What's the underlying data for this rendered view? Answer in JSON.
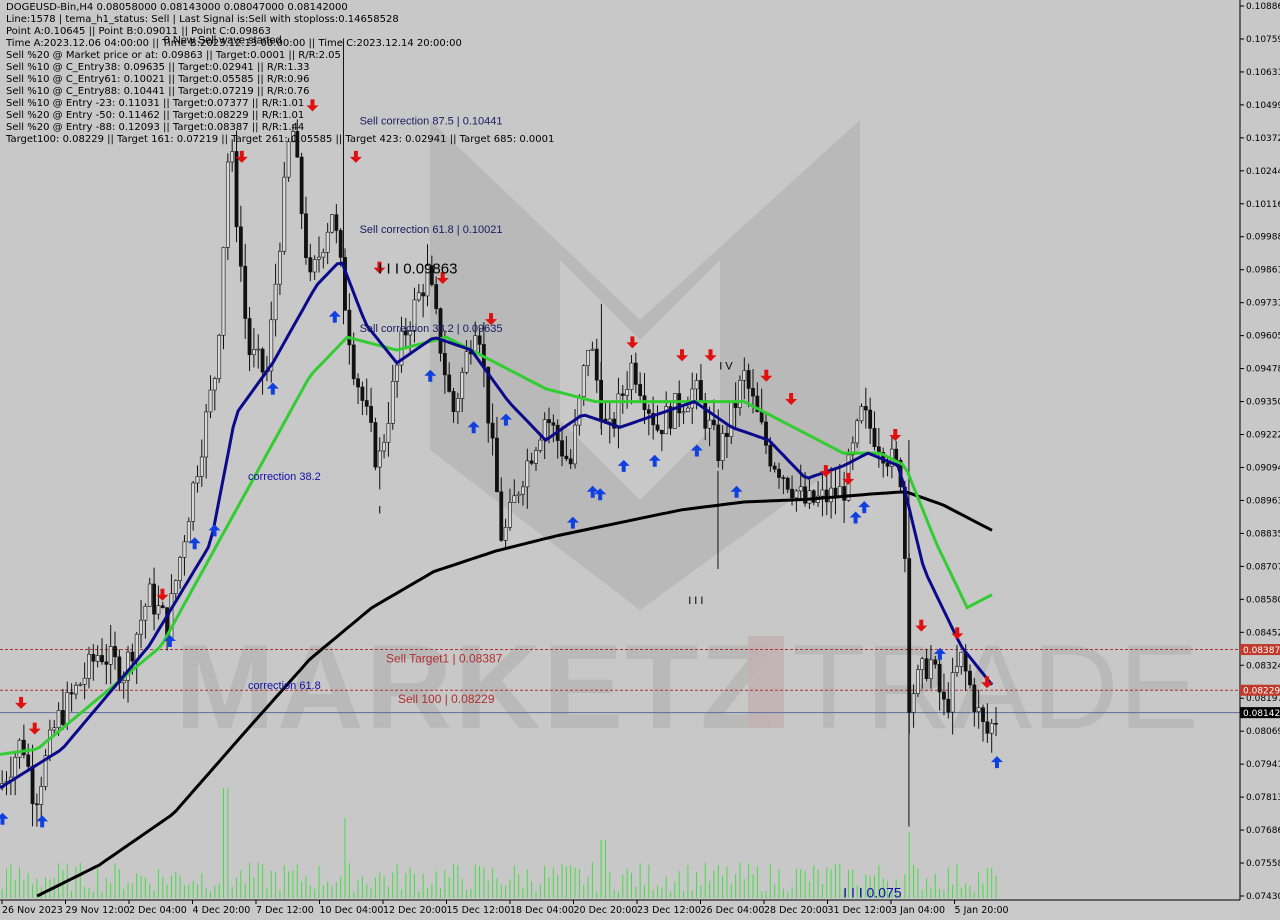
{
  "info": {
    "lines": [
      "DOGEUSD-Bin,H4  0.08058000 0.08143000 0.08047000 0.08142000",
      "Line:1578 | tema_h1_status: Sell | Last Signal is:Sell with stoploss:0.14658528",
      "Point A:0.10645 || Point B:0.09011 || Point C:0.09863",
      "Time A:2023.12.06 04:00:00 || Time B:2023.12.13 00:00:00 || Time C:2023.12.14 20:00:00",
      "Sell %20 @ Market price or at: 0.09863 || Target:0.0001 || R/R:2.05",
      "Sell %10 @ C_Entry38: 0.09635 || Target:0.02941 || R/R:1.33",
      "Sell %10 @ C_Entry61: 0.10021 || Target:0.05585 || R/R:0.96",
      "Sell %10 @ C_Entry88: 0.10441 || Target:0.07219 || R/R:0.76",
      "Sell %10 @ Entry -23: 0.11031 || Target:0.07377 || R/R:1.01",
      "Sell %20 @ Entry -50: 0.11462 || Target:0.08229 || R/R:1.01",
      "Sell %20 @ Entry -88: 0.12093 || Target:0.08387 || R/R:1.44",
      "Target100: 0.08229 || Target 161: 0.07219 || Target 261: 0.05585 || Target 423: 0.02941 || Target 685: 0.0001"
    ]
  },
  "chart_data": {
    "type": "candlestick",
    "symbol": "DOGEUSD-Bin",
    "timeframe": "H4",
    "ylim": [
      0.0743,
      0.10886
    ],
    "price_axis_ticks": [
      "0.10886",
      "0.10759",
      "0.10631",
      "0.10499",
      "0.10372",
      "0.10244",
      "0.10116",
      "0.09988",
      "0.09861",
      "0.09731",
      "0.09605",
      "0.09478",
      "0.09350",
      "0.09222",
      "0.09094",
      "0.08963",
      "0.08835",
      "0.08707",
      "0.08580",
      "0.08452",
      "0.08324",
      "0.08197",
      "0.08069",
      "0.07941",
      "0.07813",
      "0.07686",
      "0.07558",
      "0.07430"
    ],
    "time_axis_labels": [
      "26 Nov 2023",
      "29 Nov 12:00",
      "2 Dec 04:00",
      "4 Dec 20:00",
      "7 Dec 12:00",
      "10 Dec 04:00",
      "12 Dec 20:00",
      "15 Dec 12:00",
      "18 Dec 04:00",
      "20 Dec 20:00",
      "23 Dec 12:00",
      "26 Dec 04:00",
      "28 Dec 20:00",
      "31 Dec 12:00",
      "3 Jan 04:00",
      "5 Jan 20:00"
    ],
    "price_tags": [
      {
        "value": 0.08387,
        "label": "0.08387",
        "color": "#c0392b"
      },
      {
        "value": 0.08229,
        "label": "0.08229",
        "color": "#c0392b"
      },
      {
        "value": 0.08142,
        "label": "0.08142",
        "color": "#000000"
      }
    ],
    "horizontal_levels": [
      {
        "value": 0.08387,
        "style": "dashed",
        "color": "#b03030",
        "label": "Sell Target1 | 0.08387"
      },
      {
        "value": 0.08229,
        "style": "dashed",
        "color": "#b03030",
        "label": "Sell 100 | 0.08229"
      },
      {
        "value": 0.08142,
        "style": "solid",
        "color": "#5a6f9a",
        "label": ""
      }
    ],
    "text_annotations": [
      {
        "text": "Sell correction 87.5 | 0.10441",
        "x_frac": 0.29,
        "y": 0.10441,
        "color": "#1a1a60"
      },
      {
        "text": "Sell correction 61.8 | 0.10021",
        "x_frac": 0.29,
        "y": 0.10021,
        "color": "#1a1a60"
      },
      {
        "text": "Sell correction 38.2 | 0.09635",
        "x_frac": 0.29,
        "y": 0.09635,
        "color": "#1a1a60"
      },
      {
        "text": "I I I 0.09863",
        "x_frac": 0.305,
        "y": 0.09863,
        "color": "#000000",
        "size": 15
      },
      {
        "text": "correction 38.2",
        "x_frac": 0.2,
        "y": 0.0906,
        "color": "#1010aa"
      },
      {
        "text": "correction 61.8",
        "x_frac": 0.2,
        "y": 0.0825,
        "color": "#1010aa"
      },
      {
        "text": "0 New Sell wave started",
        "x_frac": 0.132,
        "y": 0.10755,
        "color": "#000000"
      },
      {
        "text": "I V",
        "x_frac": 0.58,
        "y": 0.0949,
        "color": "#000000"
      },
      {
        "text": "I",
        "x_frac": 0.305,
        "y": 0.0893,
        "color": "#000000"
      },
      {
        "text": "I I I",
        "x_frac": 0.555,
        "y": 0.0858,
        "color": "#000000"
      },
      {
        "text": "I I I 0.075",
        "x_frac": 0.68,
        "y": 0.0744,
        "color": "#1010aa",
        "size": 14
      }
    ],
    "series": [
      {
        "name": "",
        "role": "fast_ma",
        "color": "#0a0a8a"
      },
      {
        "name": "",
        "role": "mid_ma",
        "color": "#33cc33"
      },
      {
        "name": "",
        "role": "slow_ma",
        "color": "#000000"
      }
    ],
    "path_keypoints": [
      [
        0.0,
        0.0785
      ],
      [
        0.018,
        0.0804
      ],
      [
        0.028,
        0.078
      ],
      [
        0.045,
        0.081
      ],
      [
        0.08,
        0.0838
      ],
      [
        0.1,
        0.083
      ],
      [
        0.12,
        0.086
      ],
      [
        0.135,
        0.0848
      ],
      [
        0.155,
        0.09
      ],
      [
        0.175,
        0.095
      ],
      [
        0.185,
        0.104
      ],
      [
        0.2,
        0.0955
      ],
      [
        0.215,
        0.0945
      ],
      [
        0.235,
        0.1045
      ],
      [
        0.25,
        0.098
      ],
      [
        0.268,
        0.101
      ],
      [
        0.285,
        0.095
      ],
      [
        0.305,
        0.091
      ],
      [
        0.325,
        0.096
      ],
      [
        0.345,
        0.0985
      ],
      [
        0.365,
        0.093
      ],
      [
        0.385,
        0.097
      ],
      [
        0.405,
        0.088
      ],
      [
        0.42,
        0.0905
      ],
      [
        0.44,
        0.093
      ],
      [
        0.46,
        0.091
      ],
      [
        0.475,
        0.096
      ],
      [
        0.49,
        0.092
      ],
      [
        0.51,
        0.095
      ],
      [
        0.53,
        0.0925
      ],
      [
        0.56,
        0.094
      ],
      [
        0.58,
        0.0915
      ],
      [
        0.6,
        0.0945
      ],
      [
        0.62,
        0.0915
      ],
      [
        0.65,
        0.0895
      ],
      [
        0.68,
        0.09
      ],
      [
        0.695,
        0.093
      ],
      [
        0.715,
        0.0915
      ],
      [
        0.728,
        0.0905
      ],
      [
        0.733,
        0.082
      ],
      [
        0.75,
        0.0835
      ],
      [
        0.762,
        0.0815
      ],
      [
        0.775,
        0.0835
      ],
      [
        0.795,
        0.0805
      ],
      [
        0.805,
        0.0814
      ]
    ],
    "fast_ma_keypoints": [
      [
        0.0,
        0.0785
      ],
      [
        0.05,
        0.08
      ],
      [
        0.12,
        0.084
      ],
      [
        0.17,
        0.088
      ],
      [
        0.19,
        0.093
      ],
      [
        0.22,
        0.095
      ],
      [
        0.255,
        0.098
      ],
      [
        0.275,
        0.099
      ],
      [
        0.295,
        0.0965
      ],
      [
        0.32,
        0.095
      ],
      [
        0.35,
        0.096
      ],
      [
        0.38,
        0.0955
      ],
      [
        0.41,
        0.0935
      ],
      [
        0.44,
        0.092
      ],
      [
        0.47,
        0.093
      ],
      [
        0.5,
        0.0925
      ],
      [
        0.53,
        0.093
      ],
      [
        0.56,
        0.0935
      ],
      [
        0.59,
        0.0925
      ],
      [
        0.62,
        0.092
      ],
      [
        0.65,
        0.0905
      ],
      [
        0.68,
        0.091
      ],
      [
        0.7,
        0.0915
      ],
      [
        0.725,
        0.091
      ],
      [
        0.745,
        0.087
      ],
      [
        0.775,
        0.084
      ],
      [
        0.8,
        0.0825
      ]
    ],
    "mid_ma_keypoints": [
      [
        0.0,
        0.0798
      ],
      [
        0.03,
        0.08
      ],
      [
        0.08,
        0.082
      ],
      [
        0.13,
        0.084
      ],
      [
        0.17,
        0.0875
      ],
      [
        0.21,
        0.091
      ],
      [
        0.25,
        0.0945
      ],
      [
        0.28,
        0.096
      ],
      [
        0.32,
        0.0955
      ],
      [
        0.36,
        0.096
      ],
      [
        0.4,
        0.095
      ],
      [
        0.44,
        0.094
      ],
      [
        0.48,
        0.0935
      ],
      [
        0.52,
        0.0935
      ],
      [
        0.56,
        0.0935
      ],
      [
        0.6,
        0.0935
      ],
      [
        0.64,
        0.0925
      ],
      [
        0.68,
        0.0915
      ],
      [
        0.71,
        0.0915
      ],
      [
        0.73,
        0.091
      ],
      [
        0.755,
        0.088
      ],
      [
        0.78,
        0.0855
      ],
      [
        0.8,
        0.086
      ]
    ],
    "slow_ma_keypoints": [
      [
        0.03,
        0.0743
      ],
      [
        0.08,
        0.0755
      ],
      [
        0.14,
        0.0775
      ],
      [
        0.2,
        0.0808
      ],
      [
        0.25,
        0.0835
      ],
      [
        0.3,
        0.0855
      ],
      [
        0.35,
        0.0869
      ],
      [
        0.4,
        0.0877
      ],
      [
        0.45,
        0.0883
      ],
      [
        0.5,
        0.0888
      ],
      [
        0.55,
        0.0893
      ],
      [
        0.6,
        0.0896
      ],
      [
        0.65,
        0.0897
      ],
      [
        0.7,
        0.0899
      ],
      [
        0.73,
        0.09
      ],
      [
        0.76,
        0.0895
      ],
      [
        0.8,
        0.0885
      ]
    ],
    "arrows": [
      {
        "x": 0.002,
        "y": 0.0773,
        "dir": "up"
      },
      {
        "x": 0.017,
        "y": 0.0818,
        "dir": "down"
      },
      {
        "x": 0.028,
        "y": 0.0808,
        "dir": "down"
      },
      {
        "x": 0.034,
        "y": 0.0772,
        "dir": "up"
      },
      {
        "x": 0.137,
        "y": 0.0842,
        "dir": "up"
      },
      {
        "x": 0.131,
        "y": 0.086,
        "dir": "down"
      },
      {
        "x": 0.157,
        "y": 0.088,
        "dir": "up"
      },
      {
        "x": 0.173,
        "y": 0.0885,
        "dir": "up"
      },
      {
        "x": 0.195,
        "y": 0.103,
        "dir": "down"
      },
      {
        "x": 0.22,
        "y": 0.094,
        "dir": "up"
      },
      {
        "x": 0.252,
        "y": 0.105,
        "dir": "down"
      },
      {
        "x": 0.27,
        "y": 0.0968,
        "dir": "up"
      },
      {
        "x": 0.287,
        "y": 0.103,
        "dir": "down"
      },
      {
        "x": 0.306,
        "y": 0.0987,
        "dir": "down"
      },
      {
        "x": 0.347,
        "y": 0.0945,
        "dir": "up"
      },
      {
        "x": 0.357,
        "y": 0.0983,
        "dir": "down"
      },
      {
        "x": 0.382,
        "y": 0.0925,
        "dir": "up"
      },
      {
        "x": 0.396,
        "y": 0.0967,
        "dir": "down"
      },
      {
        "x": 0.408,
        "y": 0.0928,
        "dir": "up"
      },
      {
        "x": 0.462,
        "y": 0.0888,
        "dir": "up"
      },
      {
        "x": 0.478,
        "y": 0.09,
        "dir": "up"
      },
      {
        "x": 0.484,
        "y": 0.0899,
        "dir": "up"
      },
      {
        "x": 0.503,
        "y": 0.091,
        "dir": "up"
      },
      {
        "x": 0.51,
        "y": 0.0958,
        "dir": "down"
      },
      {
        "x": 0.528,
        "y": 0.0912,
        "dir": "up"
      },
      {
        "x": 0.55,
        "y": 0.0953,
        "dir": "down"
      },
      {
        "x": 0.562,
        "y": 0.0916,
        "dir": "up"
      },
      {
        "x": 0.573,
        "y": 0.0953,
        "dir": "down"
      },
      {
        "x": 0.594,
        "y": 0.09,
        "dir": "up"
      },
      {
        "x": 0.618,
        "y": 0.0945,
        "dir": "down"
      },
      {
        "x": 0.638,
        "y": 0.0936,
        "dir": "down"
      },
      {
        "x": 0.666,
        "y": 0.0908,
        "dir": "down"
      },
      {
        "x": 0.684,
        "y": 0.0905,
        "dir": "down"
      },
      {
        "x": 0.69,
        "y": 0.089,
        "dir": "up"
      },
      {
        "x": 0.697,
        "y": 0.0894,
        "dir": "up"
      },
      {
        "x": 0.722,
        "y": 0.0922,
        "dir": "down"
      },
      {
        "x": 0.743,
        "y": 0.0848,
        "dir": "down"
      },
      {
        "x": 0.758,
        "y": 0.0837,
        "dir": "up"
      },
      {
        "x": 0.772,
        "y": 0.0845,
        "dir": "down"
      },
      {
        "x": 0.796,
        "y": 0.0826,
        "dir": "down"
      },
      {
        "x": 0.804,
        "y": 0.0795,
        "dir": "up"
      }
    ]
  }
}
